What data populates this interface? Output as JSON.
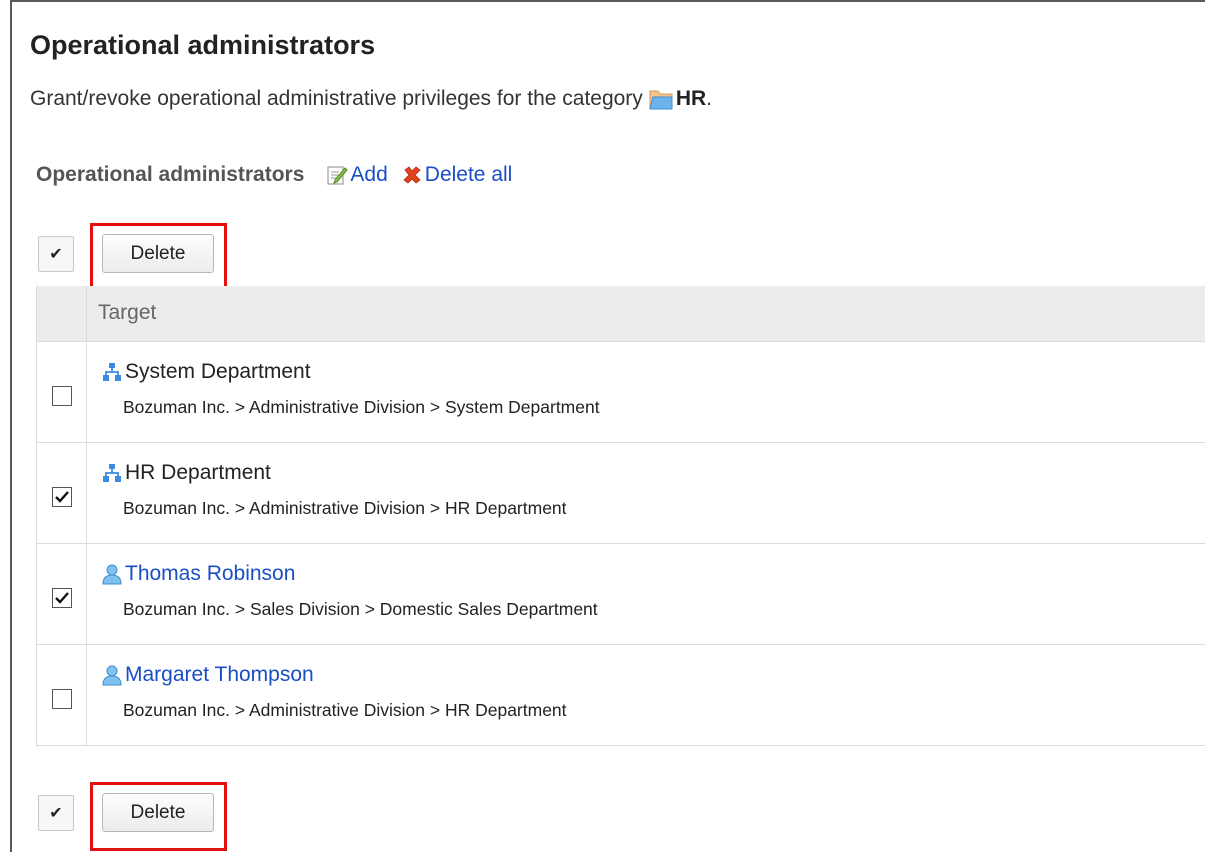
{
  "page": {
    "title": "Operational administrators",
    "description_prefix": "Grant/revoke operational administrative privileges for the category",
    "category": "HR",
    "description_suffix": "."
  },
  "section": {
    "title": "Operational administrators",
    "add_label": "Add",
    "delete_all_label": "Delete all"
  },
  "toolbar": {
    "check_all_glyph": "✔",
    "delete_label": "Delete"
  },
  "table": {
    "header_target": "Target",
    "rows": [
      {
        "name": "System Department",
        "type": "department",
        "path": "Bozuman Inc. > Administrative Division > System Department",
        "checked": false
      },
      {
        "name": "HR Department",
        "type": "department",
        "path": "Bozuman Inc. > Administrative Division > HR Department",
        "checked": true
      },
      {
        "name": "Thomas Robinson",
        "type": "user",
        "path": "Bozuman Inc. > Sales Division > Domestic Sales Department",
        "checked": true
      },
      {
        "name": "Margaret Thompson",
        "type": "user",
        "path": "Bozuman Inc. > Administrative Division > HR Department",
        "checked": false
      }
    ]
  },
  "icons": {
    "category_folder": "folder-icon",
    "add": "edit-icon",
    "delete_all": "red-x-icon",
    "department": "org-chart-icon",
    "user": "user-icon"
  },
  "colors": {
    "link": "#1a4ec7",
    "highlight": "#e01010",
    "header_bg": "#ececec"
  }
}
